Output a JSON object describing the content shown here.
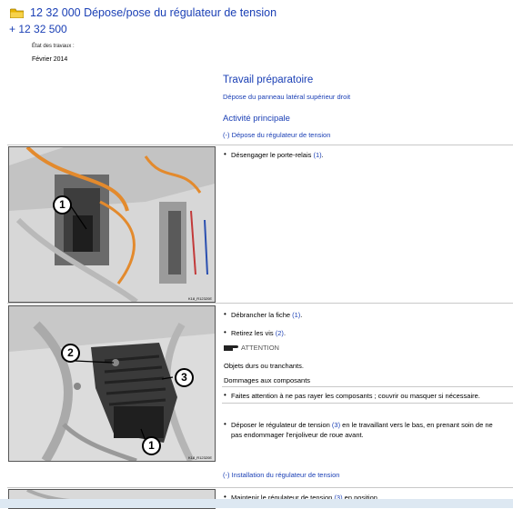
{
  "header": {
    "title": "12 32 000 Dépose/pose du régulateur de tension",
    "subtitle": "+ 12 32 500",
    "status_label": "État des travaux :",
    "status_value": "Février 2014"
  },
  "prep": {
    "title": "Travail préparatoire",
    "link": "Dépose du panneau latéral supérieur droit"
  },
  "main": {
    "title": "Activité principale",
    "removal_heading": "(-) Dépose du régulateur de tension",
    "installation_heading": "(-) Installation du régulateur de tension"
  },
  "steps": {
    "s1_pre": "Désengager le porte-relais ",
    "s1_ref": "(1)",
    "s1_post": ".",
    "s2_pre": "Débrancher la fiche ",
    "s2_ref": "(1)",
    "s2_post": ".",
    "s3_pre": "Retirez les vis ",
    "s3_ref": "(2)",
    "s3_post": ".",
    "warning_title": "ATTENTION",
    "warning_line1": "Objets durs ou tranchants.",
    "warning_line2": "Dommages aux composants",
    "warning_action": "Faites attention à ne pas rayer les composants ; couvrir ou masquer si nécessaire.",
    "s4_pre": "Déposer le régulateur de tension ",
    "s4_ref": "(3)",
    "s4_post1": " en le travaillant vers le bas, en prenant soin de ne",
    "s4_post2": "pas endommager l'enjoliveur de roue avant.",
    "s5_pre": "Maintenir le régulateur de tension ",
    "s5_ref": "(3)",
    "s5_post": " en position."
  },
  "images": {
    "img1_id": "K18_R12320E",
    "img2_id": "K18_R12320E",
    "callouts": [
      "1",
      "2",
      "3",
      "1"
    ]
  }
}
